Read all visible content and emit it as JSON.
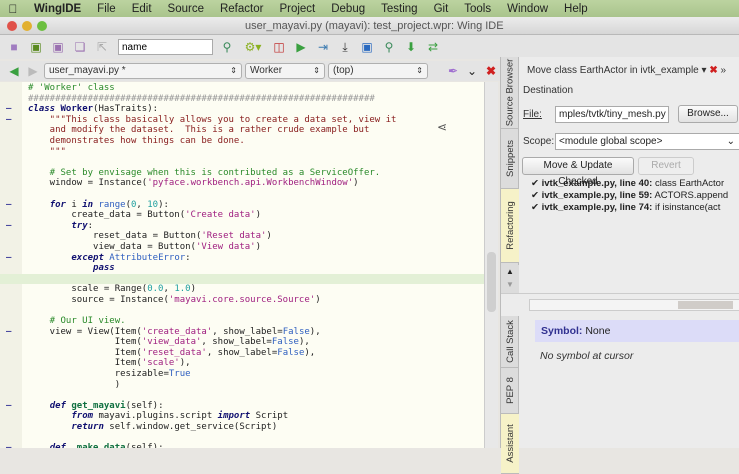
{
  "menubar": {
    "app": "WingIDE",
    "items": [
      "File",
      "Edit",
      "Source",
      "Refactor",
      "Project",
      "Debug",
      "Testing",
      "Git",
      "Tools",
      "Window",
      "Help"
    ]
  },
  "window": {
    "title": "user_mayavi.py (mayavi): test_project.wpr: Wing IDE"
  },
  "toolbar": {
    "search_value": "name"
  },
  "editor_bar": {
    "file": "user_mayavi.py *",
    "class": "Worker",
    "scope": "(top)"
  },
  "code": [
    {
      "f": 0,
      "t": [
        [
          "# 'Worker' class",
          "cm"
        ]
      ]
    },
    {
      "f": 0,
      "t": [
        [
          "################################################################",
          "hash"
        ]
      ]
    },
    {
      "f": 1,
      "t": [
        [
          "class ",
          "kw"
        ],
        [
          "Worker",
          "cls"
        ],
        [
          "(HasTraits):",
          ""
        ]
      ]
    },
    {
      "f": 1,
      "t": [
        [
          "    \"\"\"This class basically allows you to create a data set, view it",
          "doc"
        ]
      ]
    },
    {
      "f": 0,
      "t": [
        [
          "    and modify the dataset.  This is a rather crude example but",
          "doc"
        ]
      ]
    },
    {
      "f": 0,
      "t": [
        [
          "    demonstrates how things can be done.",
          "doc"
        ]
      ]
    },
    {
      "f": 0,
      "t": [
        [
          "    \"\"\"",
          "doc"
        ]
      ]
    },
    {
      "f": 0,
      "t": []
    },
    {
      "f": 0,
      "t": [
        [
          "    # Set by envisage when this is contributed as a ServiceOffer.",
          "cm"
        ]
      ]
    },
    {
      "f": 0,
      "t": [
        [
          "    window = Instance(",
          ""
        ],
        [
          "'pyface.workbench.api.WorkbenchWindow'",
          "st"
        ],
        [
          ")",
          ""
        ]
      ]
    },
    {
      "f": 0,
      "t": []
    },
    {
      "f": 1,
      "t": [
        [
          "    ",
          ""
        ],
        [
          "for",
          "kw"
        ],
        [
          " i ",
          ""
        ],
        [
          "in",
          "kw"
        ],
        [
          " ",
          ""
        ],
        [
          "range",
          "bi"
        ],
        [
          "(",
          ""
        ],
        [
          "0",
          "num"
        ],
        [
          ", ",
          ""
        ],
        [
          "10",
          "num"
        ],
        [
          "):",
          ""
        ]
      ]
    },
    {
      "f": 0,
      "t": [
        [
          "        create_data = Button(",
          ""
        ],
        [
          "'Create data'",
          "st"
        ],
        [
          ")",
          ""
        ]
      ]
    },
    {
      "f": 1,
      "t": [
        [
          "        ",
          ""
        ],
        [
          "try",
          "kw"
        ],
        [
          ":",
          ""
        ]
      ]
    },
    {
      "f": 0,
      "t": [
        [
          "            reset_data = Button(",
          ""
        ],
        [
          "'Reset data'",
          "st"
        ],
        [
          ")",
          ""
        ]
      ]
    },
    {
      "f": 0,
      "t": [
        [
          "            view_data = Button(",
          ""
        ],
        [
          "'View data'",
          "st"
        ],
        [
          ")",
          ""
        ]
      ]
    },
    {
      "f": 1,
      "t": [
        [
          "        ",
          ""
        ],
        [
          "except",
          "kw"
        ],
        [
          " ",
          ""
        ],
        [
          "AttributeError",
          "bi"
        ],
        [
          ":",
          ""
        ]
      ]
    },
    {
      "f": 0,
      "t": [
        [
          "            ",
          ""
        ],
        [
          "pass",
          "kw"
        ]
      ]
    },
    {
      "f": 0,
      "hl": true,
      "t": []
    },
    {
      "f": 0,
      "t": [
        [
          "        scale = Range(",
          ""
        ],
        [
          "0.0",
          "num"
        ],
        [
          ", ",
          ""
        ],
        [
          "1.0",
          "num"
        ],
        [
          ")",
          ""
        ]
      ]
    },
    {
      "f": 0,
      "t": [
        [
          "        source = Instance(",
          ""
        ],
        [
          "'mayavi.core.source.Source'",
          "st"
        ],
        [
          ")",
          ""
        ]
      ]
    },
    {
      "f": 0,
      "t": []
    },
    {
      "f": 0,
      "t": [
        [
          "    # Our UI view.",
          "cm"
        ]
      ]
    },
    {
      "f": 1,
      "t": [
        [
          "    view = View(Item(",
          ""
        ],
        [
          "'create_data'",
          "st"
        ],
        [
          ", show_label=",
          ""
        ],
        [
          "False",
          "bi"
        ],
        [
          "),",
          ""
        ]
      ]
    },
    {
      "f": 0,
      "t": [
        [
          "                Item(",
          ""
        ],
        [
          "'view_data'",
          "st"
        ],
        [
          ", show_label=",
          ""
        ],
        [
          "False",
          "bi"
        ],
        [
          "),",
          ""
        ]
      ]
    },
    {
      "f": 0,
      "t": [
        [
          "                Item(",
          ""
        ],
        [
          "'reset_data'",
          "st"
        ],
        [
          ", show_label=",
          ""
        ],
        [
          "False",
          "bi"
        ],
        [
          "),",
          ""
        ]
      ]
    },
    {
      "f": 0,
      "t": [
        [
          "                Item(",
          ""
        ],
        [
          "'scale'",
          "st"
        ],
        [
          "),",
          ""
        ]
      ]
    },
    {
      "f": 0,
      "t": [
        [
          "                resizable=",
          ""
        ],
        [
          "True",
          "bi"
        ]
      ]
    },
    {
      "f": 0,
      "t": [
        [
          "                )",
          ""
        ]
      ]
    },
    {
      "f": 0,
      "t": []
    },
    {
      "f": 1,
      "t": [
        [
          "    ",
          ""
        ],
        [
          "def",
          "kw"
        ],
        [
          " ",
          ""
        ],
        [
          "get_mayavi",
          "fn"
        ],
        [
          "(self):",
          ""
        ]
      ]
    },
    {
      "f": 0,
      "t": [
        [
          "        ",
          ""
        ],
        [
          "from",
          "kw"
        ],
        [
          " mayavi.plugins.script ",
          ""
        ],
        [
          "import",
          "kw"
        ],
        [
          " Script",
          ""
        ]
      ]
    },
    {
      "f": 0,
      "t": [
        [
          "        ",
          ""
        ],
        [
          "return",
          "kw"
        ],
        [
          " self.window.get_service(Script)",
          ""
        ]
      ]
    },
    {
      "f": 0,
      "t": []
    },
    {
      "f": 1,
      "t": [
        [
          "    ",
          ""
        ],
        [
          "def",
          "kw"
        ],
        [
          " ",
          ""
        ],
        [
          "_make_data",
          "fn"
        ],
        [
          "(self):",
          ""
        ]
      ]
    }
  ],
  "side_tabs_top": [
    "Source Browser",
    "Snippets",
    "Refactoring"
  ],
  "side_tabs_bottom": [
    "Call Stack",
    "PEP 8",
    "Assistant"
  ],
  "refactor": {
    "header": "Move class EarthActor in ivtk_example ▾",
    "destination_label": "Destination",
    "file_label": "File:",
    "file_value": "mples/tvtk/tiny_mesh.py",
    "browse_label": "Browse...",
    "scope_label": "Scope:",
    "scope_value": "<module global scope>",
    "move_label": "Move & Update Checked",
    "revert_label": "Revert",
    "results": [
      {
        "file": "ivtk_example.py, line 40:",
        "text": " class EarthActor",
        "checked": true
      },
      {
        "file": "ivtk_example.py, line 59:",
        "text": " ACTORS.append",
        "checked": true
      },
      {
        "file": "ivtk_example.py, line 74:",
        "text": " if isinstance(act",
        "checked": true
      }
    ]
  },
  "assistant": {
    "symbol_label": "Symbol:",
    "symbol_value": "None",
    "message": "No symbol at cursor"
  }
}
